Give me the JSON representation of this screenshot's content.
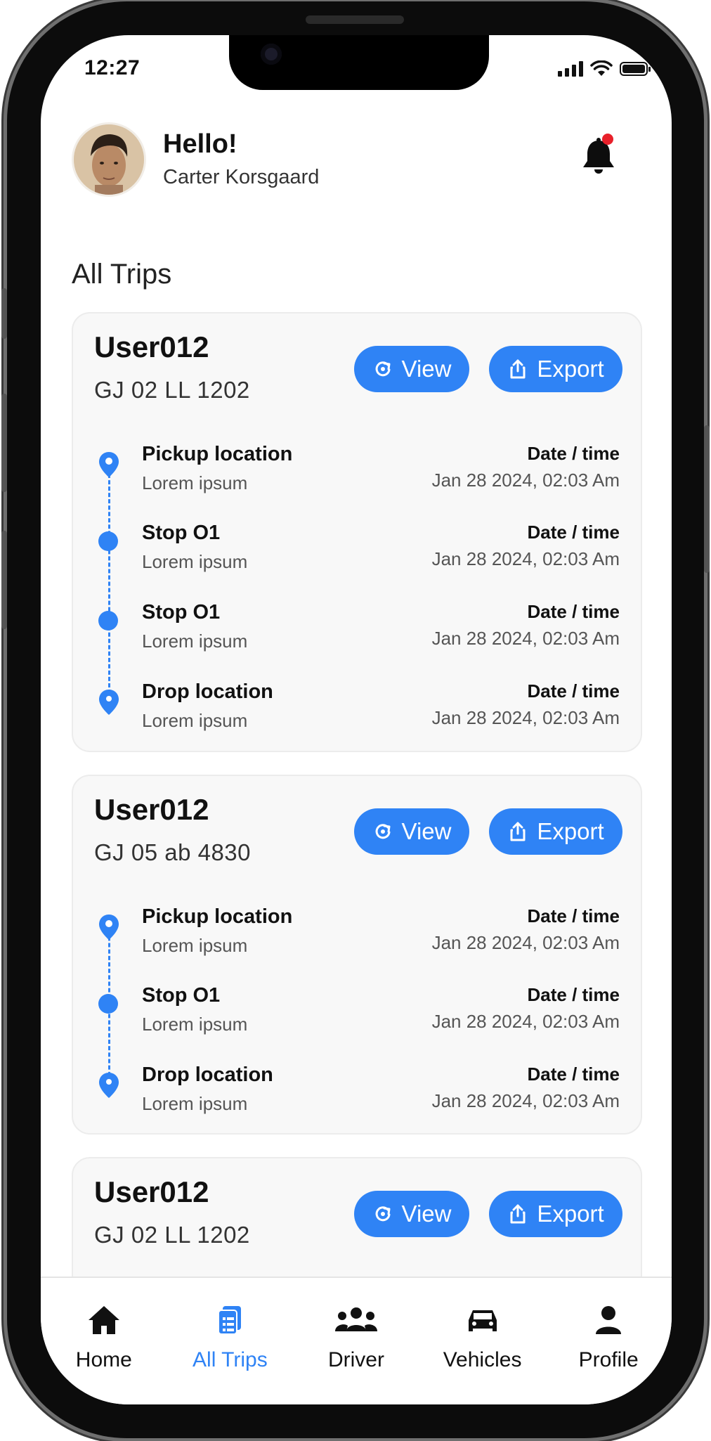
{
  "status_bar": {
    "time": "12:27"
  },
  "header": {
    "greeting": "Hello!",
    "user_name": "Carter Korsgaard"
  },
  "section_title": "All Trips",
  "trips": [
    {
      "user": "User012",
      "plate": "GJ 02 LL 1202",
      "view_label": "View",
      "export_label": "Export",
      "stops": [
        {
          "title": "Pickup location",
          "subtitle": "Lorem ipsum",
          "date_label": "Date / time",
          "date_value": "Jan 28 2024, 02:03 Am",
          "kind": "pickup"
        },
        {
          "title": "Stop O1",
          "subtitle": "Lorem ipsum",
          "date_label": "Date / time",
          "date_value": "Jan 28 2024, 02:03 Am",
          "kind": "stop"
        },
        {
          "title": "Stop O1",
          "subtitle": "Lorem ipsum",
          "date_label": "Date / time",
          "date_value": "Jan 28 2024, 02:03 Am",
          "kind": "stop"
        },
        {
          "title": "Drop location",
          "subtitle": "Lorem ipsum",
          "date_label": "Date / time",
          "date_value": "Jan 28 2024, 02:03 Am",
          "kind": "drop"
        }
      ]
    },
    {
      "user": "User012",
      "plate": "GJ 05 ab 4830",
      "view_label": "View",
      "export_label": "Export",
      "stops": [
        {
          "title": "Pickup location",
          "subtitle": "Lorem ipsum",
          "date_label": "Date / time",
          "date_value": "Jan 28 2024, 02:03 Am",
          "kind": "pickup"
        },
        {
          "title": "Stop O1",
          "subtitle": "Lorem ipsum",
          "date_label": "Date / time",
          "date_value": "Jan 28 2024, 02:03 Am",
          "kind": "stop"
        },
        {
          "title": "Drop location",
          "subtitle": "Lorem ipsum",
          "date_label": "Date / time",
          "date_value": "Jan 28 2024, 02:03 Am",
          "kind": "drop"
        }
      ]
    },
    {
      "user": "User012",
      "plate": "GJ 02 LL 1202",
      "view_label": "View",
      "export_label": "Export"
    }
  ],
  "bottom_nav": [
    {
      "label": "Home",
      "icon": "home-icon",
      "active": false
    },
    {
      "label": "All Trips",
      "icon": "trips-icon",
      "active": true
    },
    {
      "label": "Driver",
      "icon": "driver-icon",
      "active": false
    },
    {
      "label": "Vehicles",
      "icon": "car-icon",
      "active": false
    },
    {
      "label": "Profile",
      "icon": "profile-icon",
      "active": false
    }
  ],
  "colors": {
    "accent": "#2f83f5",
    "notification_dot": "#e8202a",
    "card_bg": "#f8f8f8"
  }
}
